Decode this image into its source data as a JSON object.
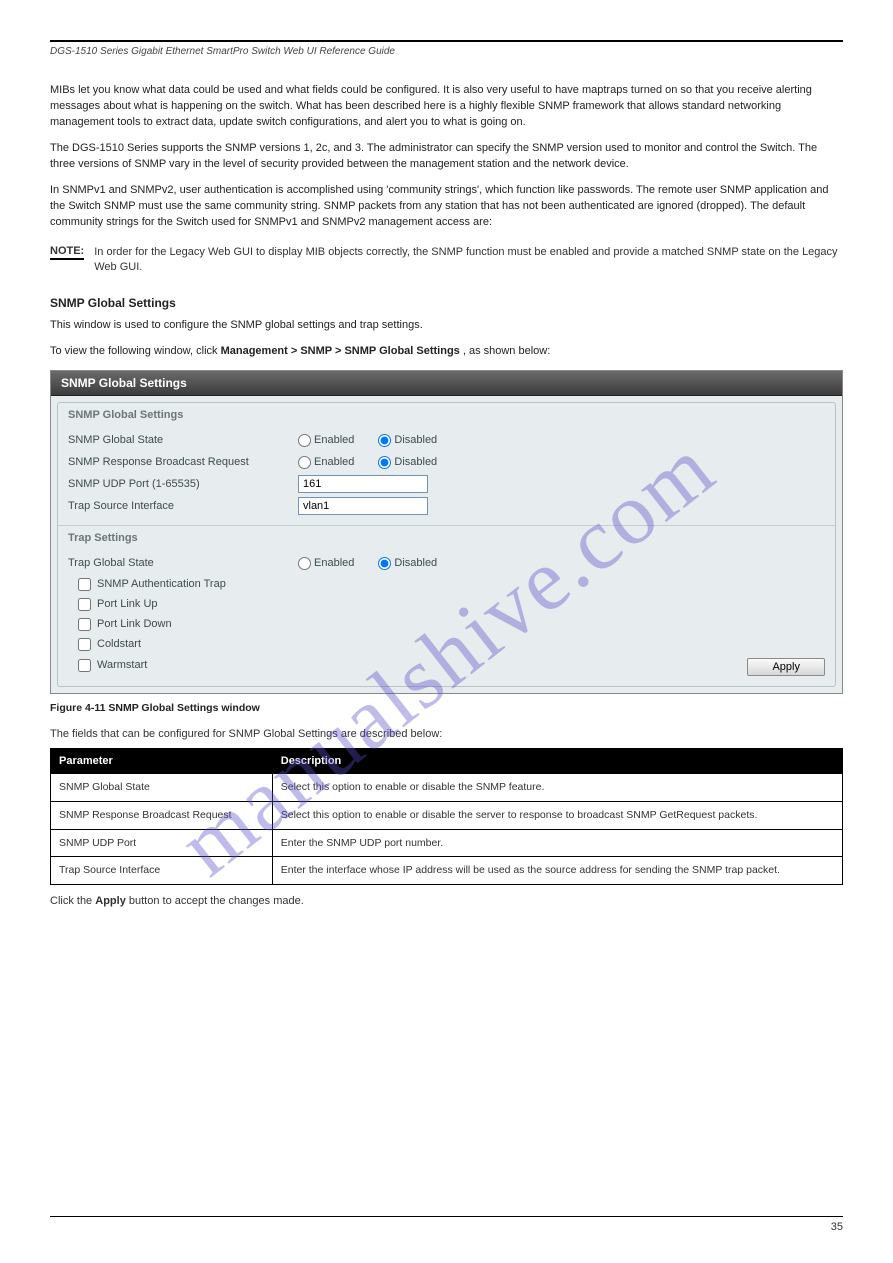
{
  "header": {
    "title": "DGS-1510 Series Gigabit Ethernet SmartPro Switch Web UI Reference Guide"
  },
  "watermark": "manualshive.com",
  "intro": {
    "p1": "MIBs let you know what data could be used and what fields could be configured. It is also very useful to have maptraps turned on so that you receive alerting messages about what is happening on the switch. What has been described here is a highly flexible SNMP framework that allows standard networking management tools to extract data, update switch configurations, and alert you to what is going on.",
    "p2": "The DGS-1510 Series supports the SNMP versions 1, 2c, and 3. The administrator can specify the SNMP version used to monitor and control the Switch. The three versions of SNMP vary in the level of security provided between the management station and the network device.",
    "p3_a": "In SNMPv1 and SNMPv2, user authentication is accomplished using 'community strings', which function like passwords. The remote user SNMP application and the Switch SNMP must use the same community string. SNMP packets from any station that has not been authenticated are ignored (dropped). The default community strings for the Switch used for SNMPv1 and SNMPv2 management access are:",
    "p3_b": ""
  },
  "note": {
    "label": "NOTE:",
    "text": "In order for the Legacy Web GUI to display MIB objects correctly, the SNMP function must be enabled and provide a matched SNMP state on the Legacy Web GUI."
  },
  "section": {
    "title": "SNMP Global Settings",
    "desc": "This window is used to configure the SNMP global settings and trap settings.",
    "nav_prefix": "To view the following window, click ",
    "nav_path": "Management > SNMP > SNMP Global Settings",
    "nav_suffix": ", as shown below:"
  },
  "shot": {
    "title": "SNMP Global Settings",
    "group1": {
      "legend": "SNMP Global Settings",
      "rows": {
        "state": {
          "label": "SNMP Global State",
          "opt_enabled": "Enabled",
          "opt_disabled": "Disabled"
        },
        "resp": {
          "label": "SNMP Response Broadcast Request",
          "opt_enabled": "Enabled",
          "opt_disabled": "Disabled"
        },
        "udp": {
          "label": "SNMP UDP Port (1-65535)",
          "value": "161"
        },
        "trap": {
          "label": "Trap Source Interface",
          "value": "vlan1"
        }
      }
    },
    "group2": {
      "legend": "Trap Settings",
      "state": {
        "label": "Trap Global State",
        "opt_enabled": "Enabled",
        "opt_disabled": "Disabled"
      },
      "cb": {
        "auth": "SNMP Authentication Trap",
        "linkup": "Port Link Up",
        "linkdown": "Port Link Down",
        "cold": "Coldstart",
        "warm": "Warmstart"
      },
      "apply": "Apply"
    }
  },
  "figure_caption": "Figure 4-11 SNMP Global Settings window",
  "params": {
    "intro": "The fields that can be configured for SNMP Global Settings are described below:",
    "head": {
      "p": "Parameter",
      "d": "Description"
    },
    "rows": [
      {
        "p": "SNMP Global State",
        "d": "Select this option to enable or disable the SNMP feature."
      },
      {
        "p": "SNMP Response Broadcast Request",
        "d": "Select this option to enable or disable the server to response to broadcast SNMP GetRequest packets."
      },
      {
        "p": "SNMP UDP Port",
        "d": "Enter the SNMP UDP port number."
      },
      {
        "p": "Trap Source Interface",
        "d": "Enter the interface whose IP address will be used as the source address for sending the SNMP trap packet."
      }
    ]
  },
  "apply_sentence_a": "Click the ",
  "apply_sentence_b": "Apply",
  "apply_sentence_c": " button to accept the changes made.",
  "footer": {
    "page": "35"
  }
}
